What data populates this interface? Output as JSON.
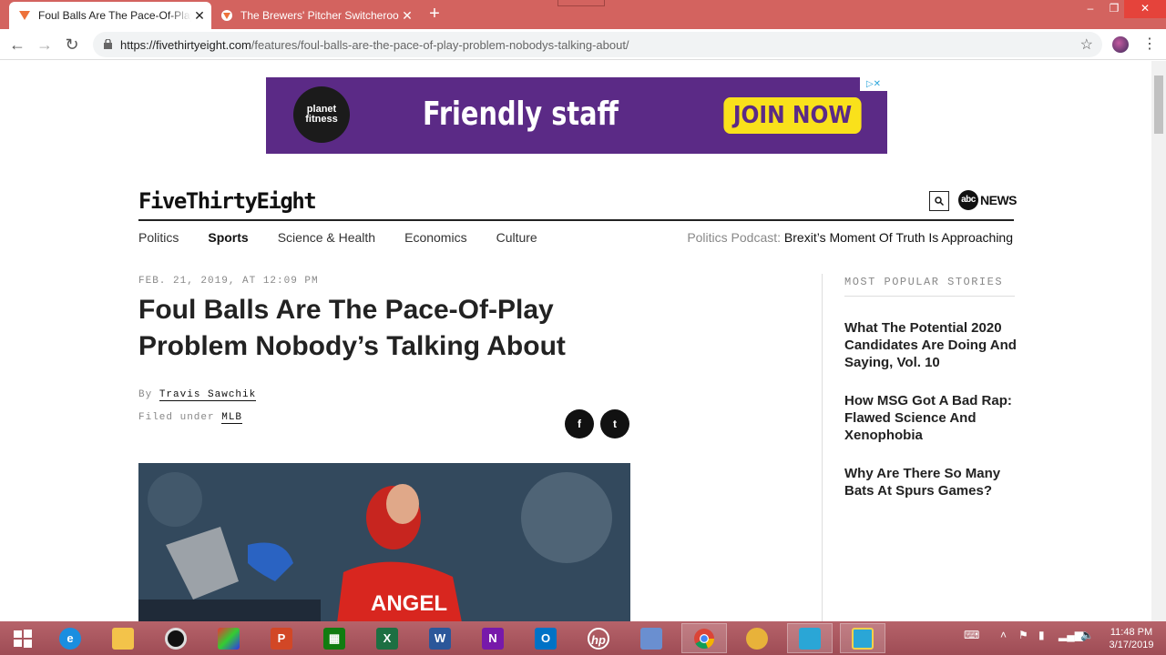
{
  "browser": {
    "tabs": [
      {
        "title": "Foul Balls Are The Pace-Of-Play P",
        "active": true
      },
      {
        "title": "The Brewers' Pitcher Switcheroo",
        "active": false
      }
    ],
    "url_host": "https://fivethirtyeight.com",
    "url_path": "/features/foul-balls-are-the-pace-of-play-problem-nobodys-talking-about/",
    "close_glyph": "✕",
    "newtab_glyph": "+",
    "win_min": "–",
    "win_max": "❐",
    "win_close": "✕"
  },
  "ad": {
    "brand": "planet fitness",
    "message": "Friendly staff",
    "cta": "JOIN NOW",
    "adchoices": "▷✕"
  },
  "site": {
    "brand": "FiveThirtyEight",
    "abc_logo": "abc",
    "abc_news": "NEWS",
    "nav": [
      "Politics",
      "Sports",
      "Science & Health",
      "Economics",
      "Culture"
    ],
    "podcast_label": "Politics Podcast:",
    "podcast_title": "Brexit’s Moment Of Truth Is Approaching"
  },
  "article": {
    "date": "FEB. 21, 2019, AT 12:09 PM",
    "headline": "Foul Balls Are The Pace-Of-Play Problem Nobody’s Talking About",
    "by_label": "By",
    "author": "Travis Sawchik",
    "filed_label": "Filed under",
    "filed_tag": "MLB",
    "share_facebook": "f",
    "share_twitter": "t"
  },
  "sidebar": {
    "title": "MOST POPULAR STORIES",
    "stories": [
      "What The Potential 2020 Candidates Are Doing And Saying, Vol. 10",
      "How MSG Got A Bad Rap: Flawed Science And Xenophobia",
      "Why Are There So Many Bats At Spurs Games?"
    ]
  },
  "taskbar": {
    "time": "11:48 PM",
    "date": "3/17/2019"
  },
  "colors": {
    "titlebar": "#d3635f",
    "ad_purple": "#5b2a86",
    "ad_yellow": "#f9e11b",
    "taskbar": "#a9565e"
  }
}
